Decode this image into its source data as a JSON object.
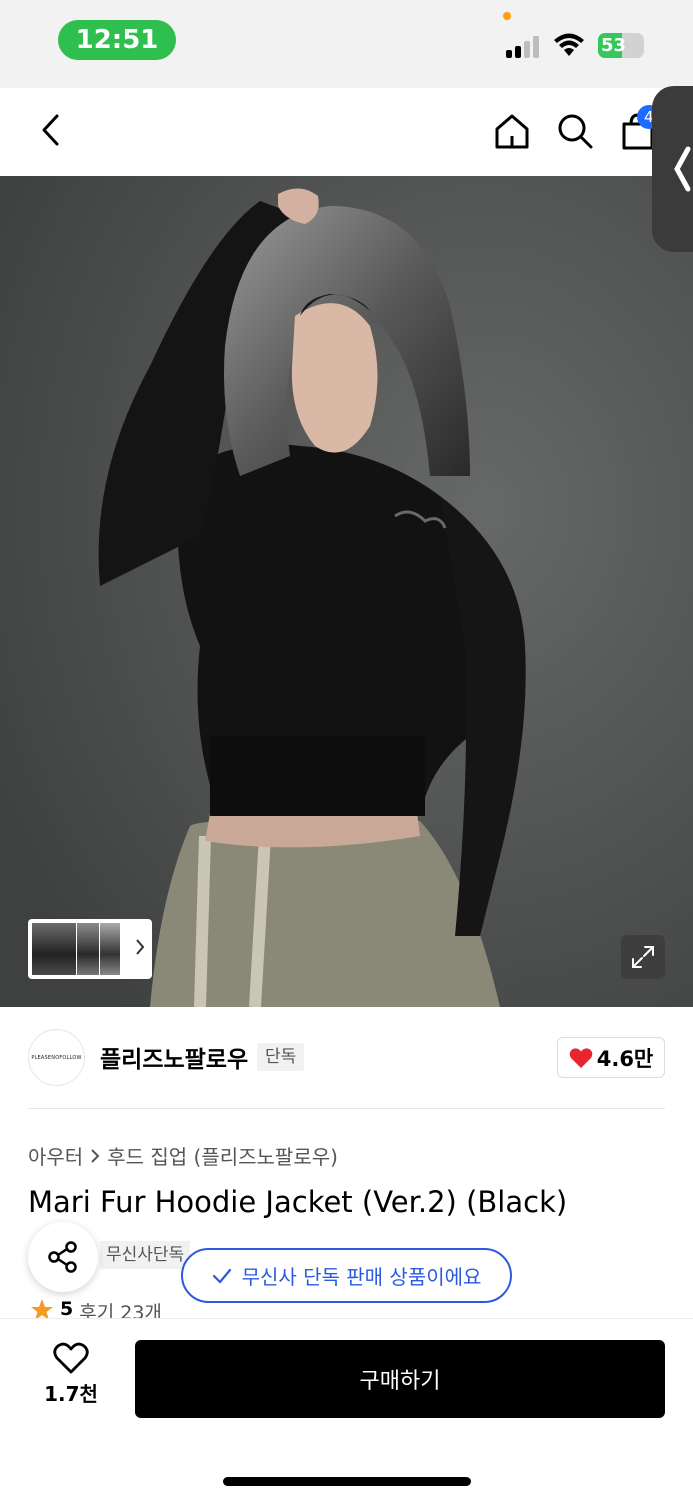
{
  "status_bar": {
    "time": "12:51",
    "battery_label": "53",
    "battery_level": 0.53
  },
  "nav": {
    "back_icon": "chevron-left-icon",
    "home_icon": "home-icon",
    "search_icon": "search-icon",
    "cart_icon": "shopping-bag-icon",
    "cart_badge": "4"
  },
  "gallery": {
    "image_alt": "product-photo",
    "thumbnail_count_shown": 3
  },
  "brand": {
    "logo_text": "PLEASENOFOLLOW",
    "name": "플리즈노팔로우",
    "exclusive_label": "단독",
    "likes": "4.6만"
  },
  "product": {
    "breadcrumb_category": "아우터",
    "breadcrumb_sub": "후드 집업 (플리즈노팔로우)",
    "title": "Mari Fur Hoodie Jacket (Ver.2) (Black)",
    "badge": "무신사단독",
    "rating_score": "5",
    "reviews": "후기 23개"
  },
  "toast": {
    "text": "무신사 단독 판매 상품이에요"
  },
  "bottom": {
    "wish_count": "1.7천",
    "buy_label": "구매하기"
  },
  "colors": {
    "accent_blue": "#2b5ae0",
    "heart_red": "#e8242f",
    "star_orange": "#f59a23",
    "buy_black": "#000000"
  }
}
